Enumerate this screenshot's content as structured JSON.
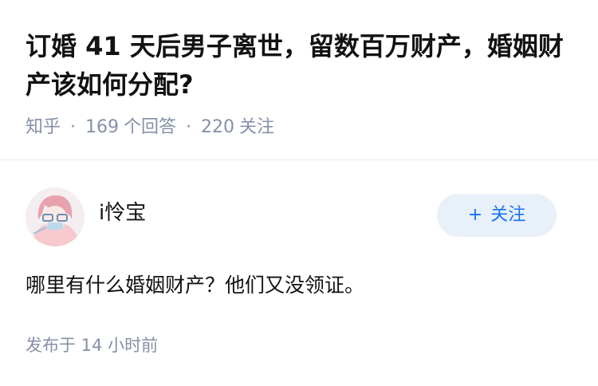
{
  "question": {
    "title": "订婚 41 天后男子离世，留数百万财产，婚姻财产该如何分配?",
    "source": "知乎",
    "answer_count": "169",
    "answer_label": "个回答",
    "follow_count": "220",
    "follow_label": "关注"
  },
  "answer": {
    "author_name": "i怜宝",
    "follow_button_label": "关注",
    "content": "哪里有什么婚姻财产？他们又没领证。",
    "publish_time": "发布于 14 小时前"
  },
  "colors": {
    "accent": "#1772f6",
    "follow_bg": "#e8f0f9",
    "meta_text": "#8590a6"
  }
}
